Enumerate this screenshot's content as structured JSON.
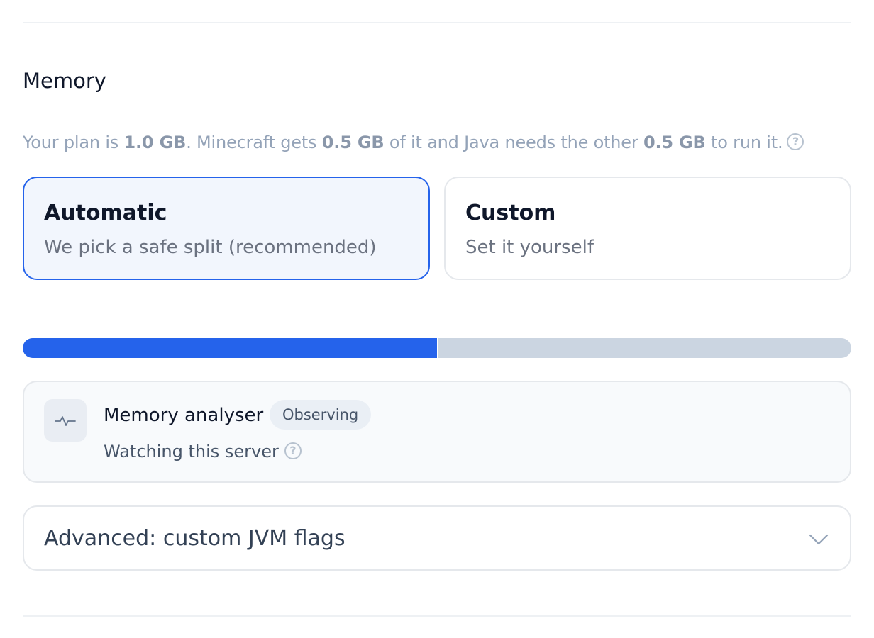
{
  "section": {
    "title": "Memory"
  },
  "description": {
    "prefix": "Your plan is ",
    "plan_total": "1.0 GB",
    "middle1": ". Minecraft gets ",
    "minecraft_share": "0.5 GB",
    "middle2": " of it and Java needs the other ",
    "java_share": "0.5 GB",
    "suffix": " to run it.",
    "help_glyph": "?"
  },
  "modes": [
    {
      "title": "Automatic",
      "subtitle": "We pick a safe split (recommended)",
      "selected": true
    },
    {
      "title": "Custom",
      "subtitle": "Set it yourself",
      "selected": false
    }
  ],
  "memory_split": {
    "minecraft_fraction": 0.5,
    "fill_color": "#2563eb",
    "track_color": "#cbd5e1"
  },
  "analyser": {
    "icon": "activity-pulse-icon",
    "title": "Memory analyser",
    "status": "Observing",
    "subtitle": "Watching this server",
    "help_glyph": "?"
  },
  "advanced": {
    "label": "Advanced: custom JVM flags",
    "icon": "chevron-down-icon",
    "expanded": false
  },
  "colors": {
    "accent": "#2563eb",
    "selected_card_bg": "#f2f6fd"
  }
}
